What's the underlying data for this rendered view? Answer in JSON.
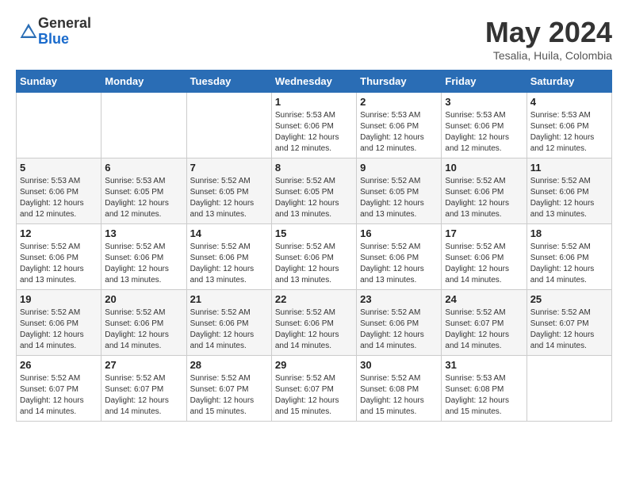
{
  "header": {
    "logo_general": "General",
    "logo_blue": "Blue",
    "month_title": "May 2024",
    "location": "Tesalia, Huila, Colombia"
  },
  "weekdays": [
    "Sunday",
    "Monday",
    "Tuesday",
    "Wednesday",
    "Thursday",
    "Friday",
    "Saturday"
  ],
  "weeks": [
    [
      {
        "day": "",
        "sunrise": "",
        "sunset": "",
        "daylight": ""
      },
      {
        "day": "",
        "sunrise": "",
        "sunset": "",
        "daylight": ""
      },
      {
        "day": "",
        "sunrise": "",
        "sunset": "",
        "daylight": ""
      },
      {
        "day": "1",
        "sunrise": "Sunrise: 5:53 AM",
        "sunset": "Sunset: 6:06 PM",
        "daylight": "Daylight: 12 hours and 12 minutes."
      },
      {
        "day": "2",
        "sunrise": "Sunrise: 5:53 AM",
        "sunset": "Sunset: 6:06 PM",
        "daylight": "Daylight: 12 hours and 12 minutes."
      },
      {
        "day": "3",
        "sunrise": "Sunrise: 5:53 AM",
        "sunset": "Sunset: 6:06 PM",
        "daylight": "Daylight: 12 hours and 12 minutes."
      },
      {
        "day": "4",
        "sunrise": "Sunrise: 5:53 AM",
        "sunset": "Sunset: 6:06 PM",
        "daylight": "Daylight: 12 hours and 12 minutes."
      }
    ],
    [
      {
        "day": "5",
        "sunrise": "Sunrise: 5:53 AM",
        "sunset": "Sunset: 6:06 PM",
        "daylight": "Daylight: 12 hours and 12 minutes."
      },
      {
        "day": "6",
        "sunrise": "Sunrise: 5:53 AM",
        "sunset": "Sunset: 6:05 PM",
        "daylight": "Daylight: 12 hours and 12 minutes."
      },
      {
        "day": "7",
        "sunrise": "Sunrise: 5:52 AM",
        "sunset": "Sunset: 6:05 PM",
        "daylight": "Daylight: 12 hours and 13 minutes."
      },
      {
        "day": "8",
        "sunrise": "Sunrise: 5:52 AM",
        "sunset": "Sunset: 6:05 PM",
        "daylight": "Daylight: 12 hours and 13 minutes."
      },
      {
        "day": "9",
        "sunrise": "Sunrise: 5:52 AM",
        "sunset": "Sunset: 6:05 PM",
        "daylight": "Daylight: 12 hours and 13 minutes."
      },
      {
        "day": "10",
        "sunrise": "Sunrise: 5:52 AM",
        "sunset": "Sunset: 6:06 PM",
        "daylight": "Daylight: 12 hours and 13 minutes."
      },
      {
        "day": "11",
        "sunrise": "Sunrise: 5:52 AM",
        "sunset": "Sunset: 6:06 PM",
        "daylight": "Daylight: 12 hours and 13 minutes."
      }
    ],
    [
      {
        "day": "12",
        "sunrise": "Sunrise: 5:52 AM",
        "sunset": "Sunset: 6:06 PM",
        "daylight": "Daylight: 12 hours and 13 minutes."
      },
      {
        "day": "13",
        "sunrise": "Sunrise: 5:52 AM",
        "sunset": "Sunset: 6:06 PM",
        "daylight": "Daylight: 12 hours and 13 minutes."
      },
      {
        "day": "14",
        "sunrise": "Sunrise: 5:52 AM",
        "sunset": "Sunset: 6:06 PM",
        "daylight": "Daylight: 12 hours and 13 minutes."
      },
      {
        "day": "15",
        "sunrise": "Sunrise: 5:52 AM",
        "sunset": "Sunset: 6:06 PM",
        "daylight": "Daylight: 12 hours and 13 minutes."
      },
      {
        "day": "16",
        "sunrise": "Sunrise: 5:52 AM",
        "sunset": "Sunset: 6:06 PM",
        "daylight": "Daylight: 12 hours and 13 minutes."
      },
      {
        "day": "17",
        "sunrise": "Sunrise: 5:52 AM",
        "sunset": "Sunset: 6:06 PM",
        "daylight": "Daylight: 12 hours and 14 minutes."
      },
      {
        "day": "18",
        "sunrise": "Sunrise: 5:52 AM",
        "sunset": "Sunset: 6:06 PM",
        "daylight": "Daylight: 12 hours and 14 minutes."
      }
    ],
    [
      {
        "day": "19",
        "sunrise": "Sunrise: 5:52 AM",
        "sunset": "Sunset: 6:06 PM",
        "daylight": "Daylight: 12 hours and 14 minutes."
      },
      {
        "day": "20",
        "sunrise": "Sunrise: 5:52 AM",
        "sunset": "Sunset: 6:06 PM",
        "daylight": "Daylight: 12 hours and 14 minutes."
      },
      {
        "day": "21",
        "sunrise": "Sunrise: 5:52 AM",
        "sunset": "Sunset: 6:06 PM",
        "daylight": "Daylight: 12 hours and 14 minutes."
      },
      {
        "day": "22",
        "sunrise": "Sunrise: 5:52 AM",
        "sunset": "Sunset: 6:06 PM",
        "daylight": "Daylight: 12 hours and 14 minutes."
      },
      {
        "day": "23",
        "sunrise": "Sunrise: 5:52 AM",
        "sunset": "Sunset: 6:06 PM",
        "daylight": "Daylight: 12 hours and 14 minutes."
      },
      {
        "day": "24",
        "sunrise": "Sunrise: 5:52 AM",
        "sunset": "Sunset: 6:07 PM",
        "daylight": "Daylight: 12 hours and 14 minutes."
      },
      {
        "day": "25",
        "sunrise": "Sunrise: 5:52 AM",
        "sunset": "Sunset: 6:07 PM",
        "daylight": "Daylight: 12 hours and 14 minutes."
      }
    ],
    [
      {
        "day": "26",
        "sunrise": "Sunrise: 5:52 AM",
        "sunset": "Sunset: 6:07 PM",
        "daylight": "Daylight: 12 hours and 14 minutes."
      },
      {
        "day": "27",
        "sunrise": "Sunrise: 5:52 AM",
        "sunset": "Sunset: 6:07 PM",
        "daylight": "Daylight: 12 hours and 14 minutes."
      },
      {
        "day": "28",
        "sunrise": "Sunrise: 5:52 AM",
        "sunset": "Sunset: 6:07 PM",
        "daylight": "Daylight: 12 hours and 15 minutes."
      },
      {
        "day": "29",
        "sunrise": "Sunrise: 5:52 AM",
        "sunset": "Sunset: 6:07 PM",
        "daylight": "Daylight: 12 hours and 15 minutes."
      },
      {
        "day": "30",
        "sunrise": "Sunrise: 5:52 AM",
        "sunset": "Sunset: 6:08 PM",
        "daylight": "Daylight: 12 hours and 15 minutes."
      },
      {
        "day": "31",
        "sunrise": "Sunrise: 5:53 AM",
        "sunset": "Sunset: 6:08 PM",
        "daylight": "Daylight: 12 hours and 15 minutes."
      },
      {
        "day": "",
        "sunrise": "",
        "sunset": "",
        "daylight": ""
      }
    ]
  ]
}
